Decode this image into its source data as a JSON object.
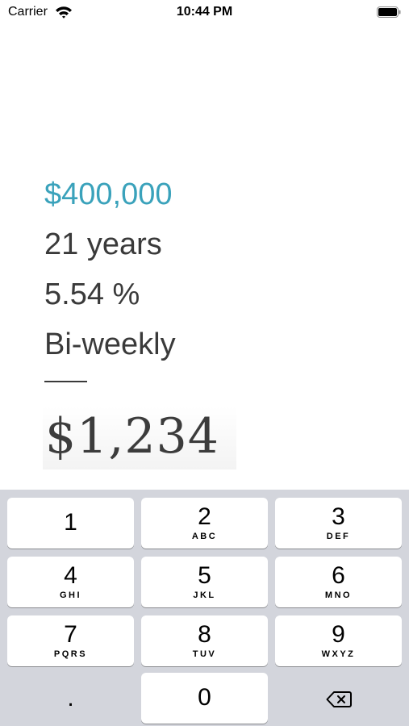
{
  "status_bar": {
    "carrier": "Carrier",
    "time": "10:44 PM",
    "wifi_icon": "wifi-icon",
    "battery_icon": "battery-icon"
  },
  "mortgage": {
    "amount": "$400,000",
    "term": "21 years",
    "rate": "5.54 %",
    "frequency": "Bi-weekly",
    "payment": "$1,234",
    "accent_color": "#3aa2bb"
  },
  "keypad": {
    "keys": [
      {
        "digit": "1",
        "letters": ""
      },
      {
        "digit": "2",
        "letters": "ABC"
      },
      {
        "digit": "3",
        "letters": "DEF"
      },
      {
        "digit": "4",
        "letters": "GHI"
      },
      {
        "digit": "5",
        "letters": "JKL"
      },
      {
        "digit": "6",
        "letters": "MNO"
      },
      {
        "digit": "7",
        "letters": "PQRS"
      },
      {
        "digit": "8",
        "letters": "TUV"
      },
      {
        "digit": "9",
        "letters": "WXYZ"
      },
      {
        "digit": "0",
        "letters": ""
      }
    ],
    "decimal": ".",
    "delete_icon": "backspace-icon"
  }
}
